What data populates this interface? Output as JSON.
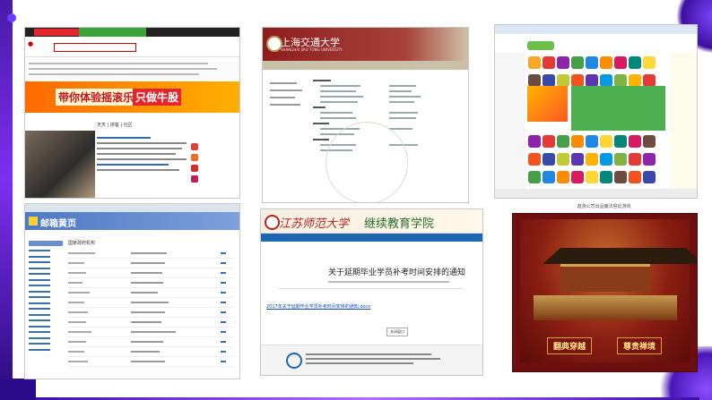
{
  "screenshots": {
    "portal": {
      "banner_text": "带你体验摇滚乐趣",
      "banner_cta": "只做牛股",
      "tabs": "天天 | 拼客 | 社区"
    },
    "university": {
      "title": "上海交通大学",
      "subtitle": "SHANGHAI JIAO TONG UNIVERSITY"
    },
    "game_portal": {},
    "yellow_pages": {
      "logo_text": "邮箱黄页",
      "table_title": "国家政府机构"
    },
    "education_notice": {
      "university": "江苏师范大学",
      "department": "继续教育学院",
      "article_title": "关于延期毕业学员补考时间安排的通知",
      "attachment_link": "2017年关于延期毕业学员补考时间安排的通知.docx",
      "close_button": "关闭窗口"
    },
    "palace_game": {
      "caption": "遨游公司出品魔法宫廷游戏",
      "button_left": "翻典穿越",
      "button_right": "尊贵禅境"
    }
  },
  "colors": {
    "accent_purple": "#6f3bff",
    "portal_red": "#e4262c",
    "university_maroon": "#8e1d1d",
    "mail_blue": "#4d78c4",
    "education_blue": "#1d67b0",
    "palace_red": "#6d0f0f"
  }
}
